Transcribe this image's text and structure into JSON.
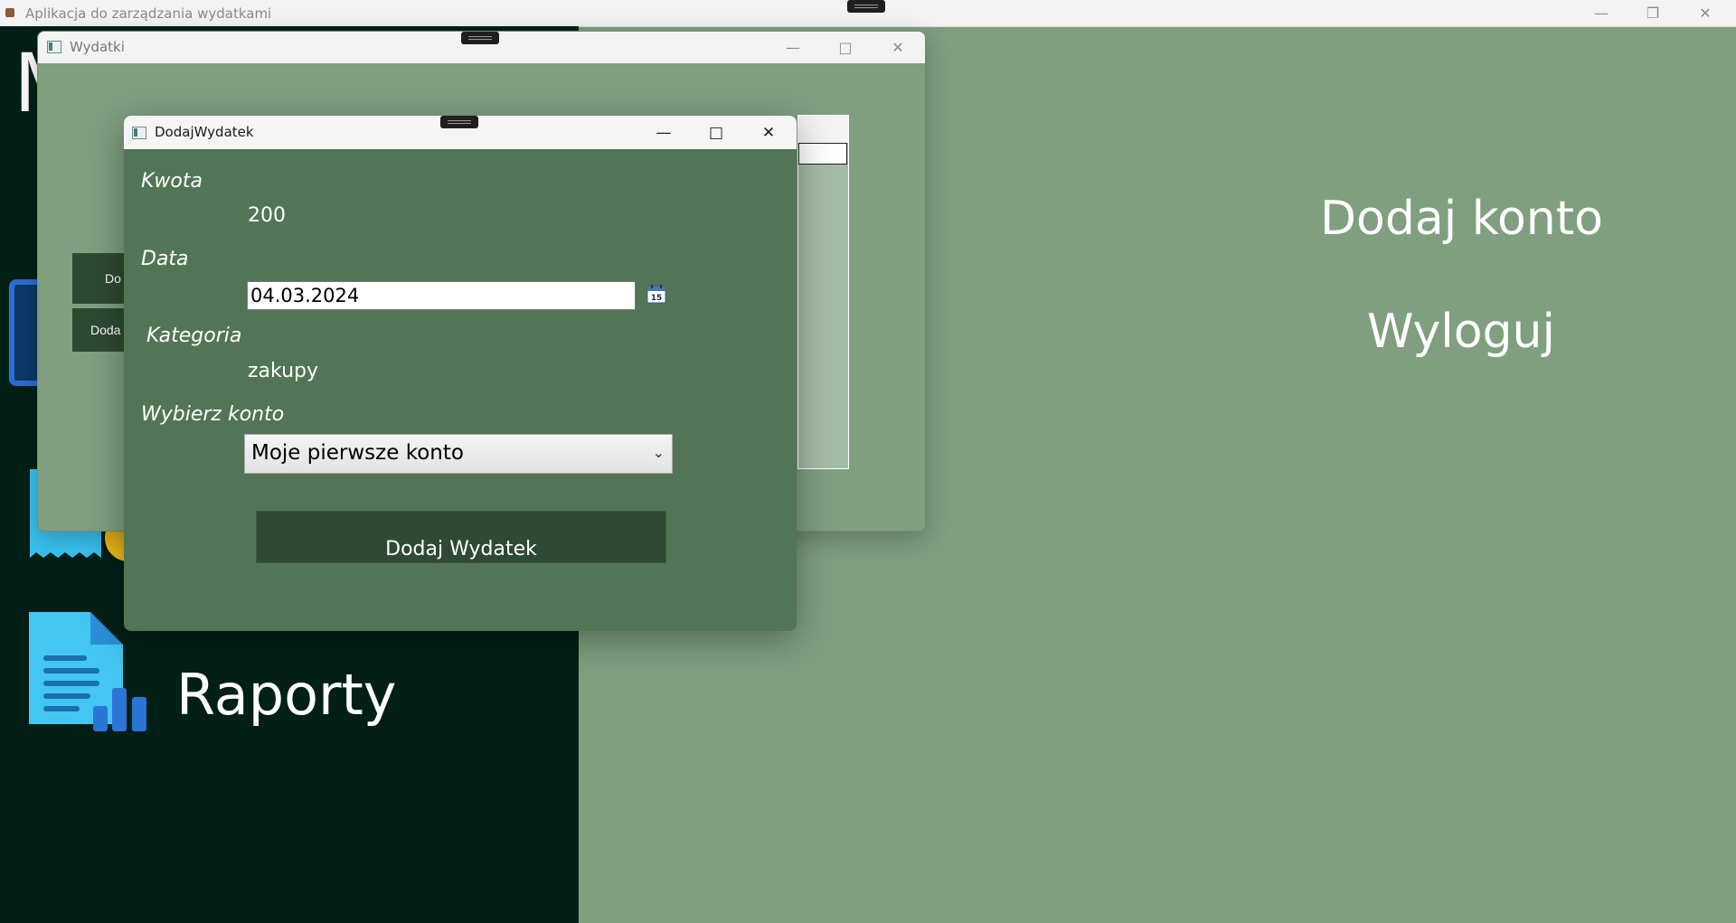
{
  "main_window": {
    "title": "Aplikacja do zarządzania wydatkami"
  },
  "sidebar": {
    "partial_heading": "M",
    "raporty_label": "Raporty"
  },
  "right_panel": {
    "add_account_label": "Dodaj konto",
    "logout_label": "Wyloguj"
  },
  "wydatki_window": {
    "title": "Wydatki",
    "side_button_1": "Do",
    "side_button_2": "Doda"
  },
  "dialog": {
    "title": "DodajWydatek",
    "amount_label": "Kwota",
    "amount_value": "200",
    "date_label": "Data",
    "date_value": "04.03.2024",
    "calendar_day": "15",
    "category_label": "Kategoria",
    "category_value": "zakupy",
    "account_label": "Wybierz konto",
    "account_selected": "Moje pierwsze konto",
    "submit_label": "Dodaj Wydatek"
  },
  "colors": {
    "sidebar_bg": "#022016",
    "content_bg": "#7f9f7f",
    "dialog_bg": "#527556",
    "button_bg": "#2f4a34"
  }
}
